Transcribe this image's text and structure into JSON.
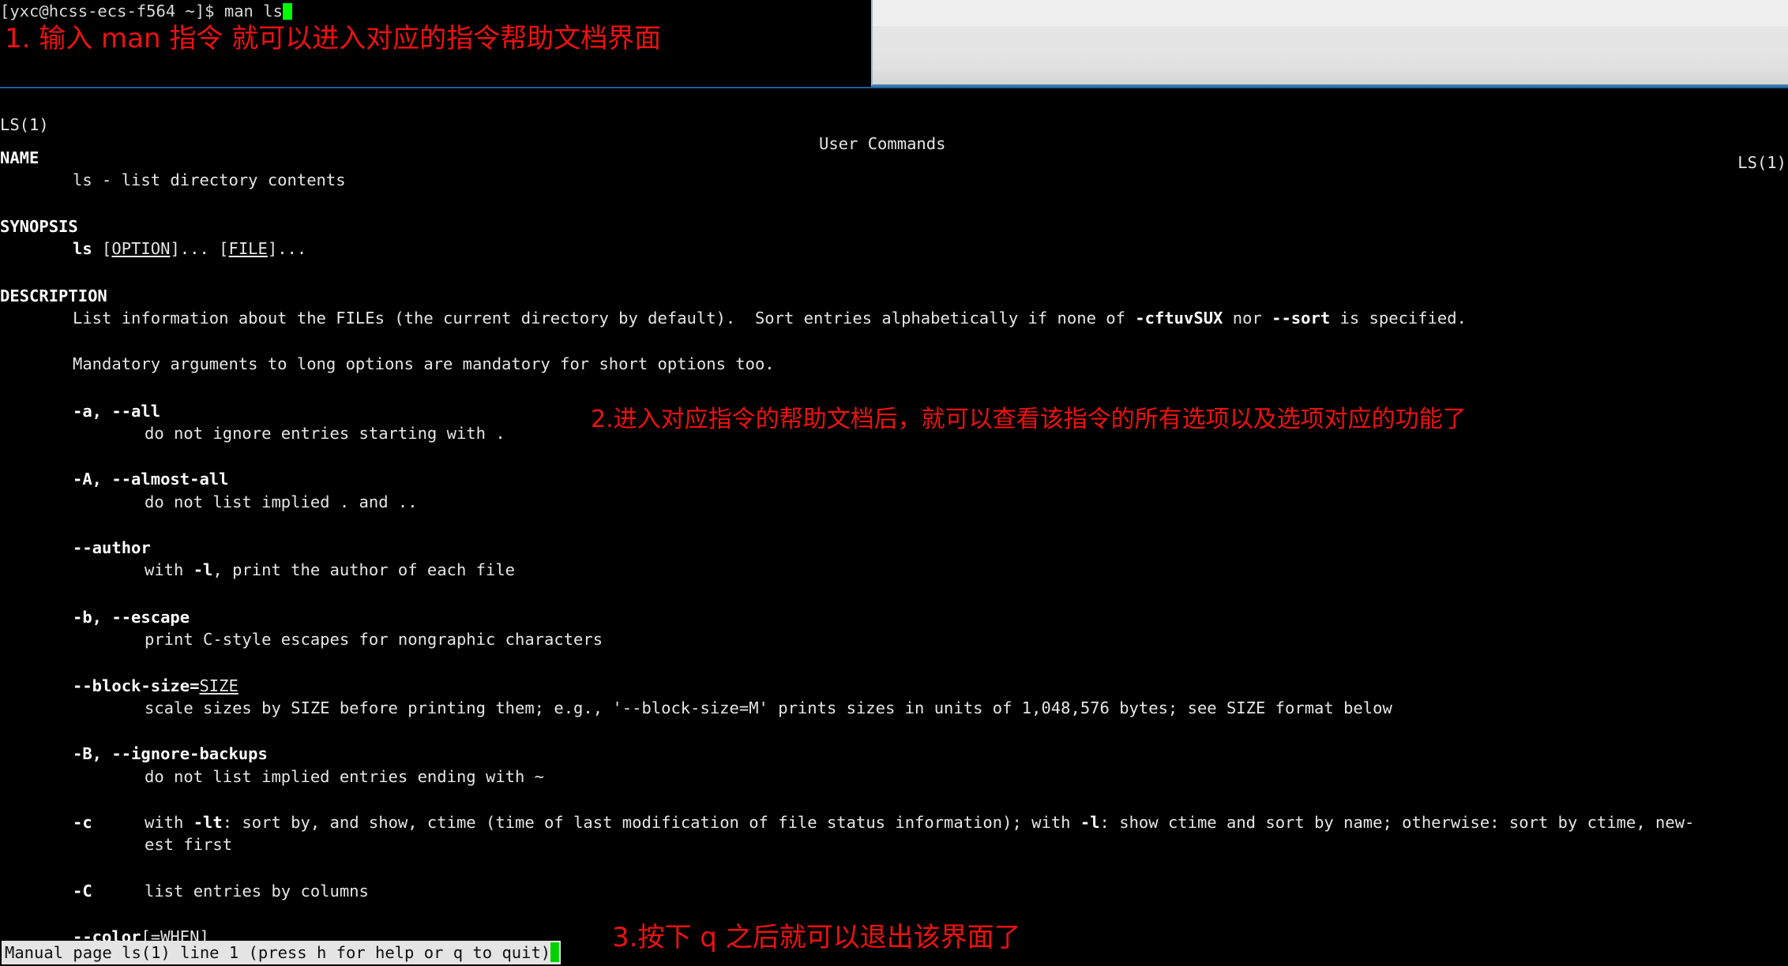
{
  "terminal": {
    "prompt": "[yxc@hcss-ecs-f564 ~]$ ",
    "command": "man ls",
    "cursor": "block-cursor"
  },
  "man_page": {
    "header": {
      "left": "LS(1)",
      "center": "User Commands",
      "right": "LS(1)"
    },
    "sections": {
      "name_heading": "NAME",
      "name_body": "ls - list directory contents",
      "synopsis_heading": "SYNOPSIS",
      "synopsis_cmd": "ls",
      "synopsis_rest_open": " [",
      "synopsis_option": "OPTION",
      "synopsis_mid": "]... [",
      "synopsis_file": "FILE",
      "synopsis_close": "]...",
      "description_heading": "DESCRIPTION",
      "description_p1_a": "List information about the FILEs (the current directory by default).  Sort entries alphabetically if none of ",
      "description_p1_b": "-cftuvSUX",
      "description_p1_c": " nor ",
      "description_p1_d": "--sort",
      "description_p1_e": " is specified.",
      "description_p2": "Mandatory arguments to long options are mandatory for short options too."
    },
    "options": [
      {
        "flag": "-a, --all",
        "desc": "do not ignore entries starting with ."
      },
      {
        "flag": "-A, --almost-all",
        "desc": "do not list implied . and .."
      },
      {
        "flag": "--author",
        "desc_a": "with ",
        "desc_b": "-l",
        "desc_c": ", print the author of each file"
      },
      {
        "flag": "-b, --escape",
        "desc": "print C-style escapes for nongraphic characters"
      },
      {
        "flag": "--block-size=",
        "flag_arg": "SIZE",
        "desc": "scale sizes by SIZE before printing them; e.g., '--block-size=M' prints sizes in units of 1,048,576 bytes; see SIZE format below"
      },
      {
        "flag": "-B, --ignore-backups",
        "desc": "do not list implied entries ending with ~"
      },
      {
        "flag": "-c",
        "desc_a": "with ",
        "desc_b": "-lt",
        "desc_c": ": sort by, and show, ctime (time of last modification of file status information); with ",
        "desc_d": "-l",
        "desc_e": ": show ctime and sort by name; otherwise: sort by ctime, new-",
        "desc_wrap": "est first"
      },
      {
        "flag": "-C",
        "desc": "list entries by columns"
      },
      {
        "flag": "--color",
        "flag_open": "[=",
        "flag_arg": "WHEN",
        "flag_close": "]"
      }
    ],
    "status_bar": "Manual page ls(1) line 1 (press h for help or q to quit)"
  },
  "annotations": [
    {
      "id": 1,
      "text": "1. 输入 man 指令 就可以进入对应的指令帮助文档界面"
    },
    {
      "id": 2,
      "text": "2.进入对应指令的帮助文档后，就可以查看该指令的所有选项以及选项对应的功能了"
    },
    {
      "id": 3,
      "text": "3.按下 q 之后就可以退出该界面了"
    }
  ],
  "colors": {
    "terminal_bg": "#000000",
    "terminal_fg": "#e6e6e6",
    "cursor_green": "#00ff00",
    "annotation_red": "#ee1111",
    "status_bg": "#e4e4e4",
    "window_accent_blue": "#3e7eb0"
  }
}
